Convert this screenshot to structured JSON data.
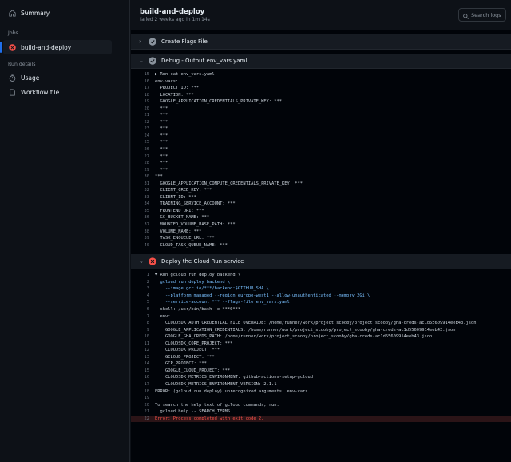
{
  "sidebar": {
    "summary_label": "Summary",
    "jobs_section": "Jobs",
    "job_label": "build-and-deploy",
    "run_details_section": "Run details",
    "usage_label": "Usage",
    "workflow_file_label": "Workflow file"
  },
  "header": {
    "title": "build-and-deploy",
    "subtitle": "failed 2 weeks ago in 1m 14s",
    "search_placeholder": "Search logs"
  },
  "steps": [
    {
      "name": "Create Flags File",
      "status": "success"
    },
    {
      "name": "Debug - Output env_vars.yaml",
      "status": "success"
    },
    {
      "name": "Deploy the Cloud Run service",
      "status": "failure"
    }
  ],
  "colors": {
    "success": "#8b949e",
    "failure": "#f85149",
    "accent": "#1f6feb"
  },
  "debug_log": [
    {
      "n": "15",
      "t": "▶ Run cat env_vars.yaml"
    },
    {
      "n": "16",
      "t": "env-vars:"
    },
    {
      "n": "17",
      "t": "  PROJECT_ID: ***"
    },
    {
      "n": "18",
      "t": "  LOCATION: ***"
    },
    {
      "n": "19",
      "t": "  GOOGLE_APPLICATION_CREDENTIALS_PRIVATE_KEY: ***"
    },
    {
      "n": "20",
      "t": "  ***"
    },
    {
      "n": "21",
      "t": "  ***"
    },
    {
      "n": "22",
      "t": "  ***"
    },
    {
      "n": "23",
      "t": "  ***"
    },
    {
      "n": "24",
      "t": "  ***"
    },
    {
      "n": "25",
      "t": "  ***"
    },
    {
      "n": "26",
      "t": "  ***"
    },
    {
      "n": "27",
      "t": "  ***"
    },
    {
      "n": "28",
      "t": "  ***"
    },
    {
      "n": "29",
      "t": "  ***"
    },
    {
      "n": "30",
      "t": "***"
    },
    {
      "n": "31",
      "t": "  GOOGLE_APPLICATION_COMPUTE_CREDENTIALS_PRIVATE_KEY: ***"
    },
    {
      "n": "32",
      "t": "  CLIENT_CRED_KEY: ***"
    },
    {
      "n": "33",
      "t": "  CLIENT_ID: ***"
    },
    {
      "n": "34",
      "t": "  TRAINING_SERVICE_ACCOUNT: ***"
    },
    {
      "n": "35",
      "t": "  FRONTEND_URI: ***"
    },
    {
      "n": "36",
      "t": "  GC_BUCKET_NAME: ***"
    },
    {
      "n": "37",
      "t": "  MOUNTED_VOLUME_BASE_PATH: ***"
    },
    {
      "n": "38",
      "t": "  VOLUME_NAME: ***"
    },
    {
      "n": "39",
      "t": "  TASK_ENQUEUE_URL: ***"
    },
    {
      "n": "40",
      "t": "  CLOUD_TASK_QUEUE_NAME: ***"
    }
  ],
  "deploy_log": [
    {
      "n": "1",
      "t": "▼ Run gcloud run deploy backend \\"
    },
    {
      "n": "2",
      "t": "  gcloud run deploy backend \\",
      "style": "cmd"
    },
    {
      "n": "3",
      "t": "    --image gcr.io/***/backend:$GITHUB_SHA \\",
      "style": "cmd"
    },
    {
      "n": "4",
      "t": "    --platform managed --region europe-west1 --allow-unauthenticated --memory 2Gi \\",
      "style": "cmd"
    },
    {
      "n": "5",
      "t": "    --service-account *** --flags-file env_vars.yaml",
      "style": "cmd"
    },
    {
      "n": "6",
      "t": "  shell: /usr/bin/bash -e ***0***"
    },
    {
      "n": "7",
      "t": "  env:"
    },
    {
      "n": "8",
      "t": "    CLOUDSDK_AUTH_CREDENTIAL_FILE_OVERRIDE: /home/runner/work/project_scooby/project_scooby/gha-creds-ac1d55609914eeb43.json"
    },
    {
      "n": "9",
      "t": "    GOOGLE_APPLICATION_CREDENTIALS: /home/runner/work/project_scooby/project_scooby/gha-creds-ac1d55609914eeb43.json"
    },
    {
      "n": "10",
      "t": "    GOOGLE_GHA_CREDS_PATH: /home/runner/work/project_scooby/project_scooby/gha-creds-ac1d55609914eeb43.json"
    },
    {
      "n": "11",
      "t": "    CLOUDSDK_CORE_PROJECT: ***"
    },
    {
      "n": "12",
      "t": "    CLOUDSDK_PROJECT: ***"
    },
    {
      "n": "13",
      "t": "    GCLOUD_PROJECT: ***"
    },
    {
      "n": "14",
      "t": "    GCP_PROJECT: ***"
    },
    {
      "n": "15",
      "t": "    GOOGLE_CLOUD_PROJECT: ***"
    },
    {
      "n": "16",
      "t": "    CLOUDSDK_METRICS_ENVIRONMENT: github-actions-setup-gcloud"
    },
    {
      "n": "17",
      "t": "    CLOUDSDK_METRICS_ENVIRONMENT_VERSION: 2.1.1"
    },
    {
      "n": "18",
      "t": "ERROR: (gcloud.run.deploy) unrecognized arguments: env-vars"
    },
    {
      "n": "19",
      "t": ""
    },
    {
      "n": "20",
      "t": "To search the help text of gcloud commands, run:"
    },
    {
      "n": "21",
      "t": "  gcloud help -- SEARCH_TERMS"
    },
    {
      "n": "22",
      "t": "Error: Process completed with exit code 2.",
      "style": "err"
    }
  ]
}
